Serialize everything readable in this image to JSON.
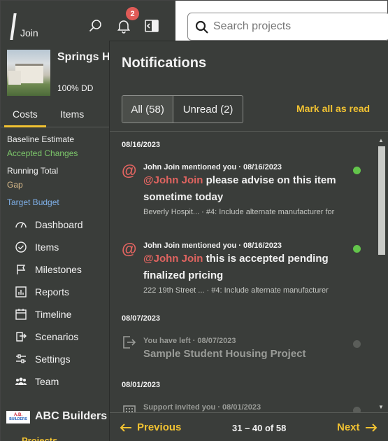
{
  "app": {
    "brand": "Join"
  },
  "header": {
    "notification_count": "2",
    "search": {
      "placeholder": "Search projects",
      "value": ""
    }
  },
  "project": {
    "name": "Springs He",
    "status": "100% DD",
    "tabs": [
      "Costs",
      "Items"
    ]
  },
  "budget": {
    "baseline": "Baseline Estimate",
    "accepted": "Accepted Changes",
    "running": "Running Total",
    "gap": "Gap",
    "target": "Target Budget"
  },
  "nav": {
    "items": [
      {
        "label": "Dashboard",
        "icon": "gauge-icon"
      },
      {
        "label": "Items",
        "icon": "check-circle-icon"
      },
      {
        "label": "Milestones",
        "icon": "flag-icon"
      },
      {
        "label": "Reports",
        "icon": "bar-chart-icon"
      },
      {
        "label": "Timeline",
        "icon": "calendar-icon"
      },
      {
        "label": "Scenarios",
        "icon": "scenarios-icon"
      },
      {
        "label": "Settings",
        "icon": "sliders-icon"
      },
      {
        "label": "Team",
        "icon": "team-icon"
      }
    ]
  },
  "company": {
    "name": "ABC Builders",
    "logo_line1": "A.B.",
    "logo_line2": "BUILDERS",
    "projects_label": "Projects"
  },
  "notifications": {
    "title": "Notifications",
    "filters": {
      "all": "All (58)",
      "unread": "Unread (2)"
    },
    "mark_all": "Mark all as read",
    "groups": [
      {
        "date": "08/16/2023"
      },
      {
        "date": "08/07/2023"
      },
      {
        "date": "08/01/2023"
      }
    ],
    "items": [
      {
        "meta": "John Join mentioned you · 08/16/2023",
        "mention": "@John Join",
        "text": " please advise on this item sometime today",
        "sub": "Beverly Hospit... · #4: Include alternate manufacturer for",
        "unread": true
      },
      {
        "meta": "John Join mentioned you · 08/16/2023",
        "mention": "@John Join",
        "text": " this is accepted pending finalized pricing",
        "sub": "222 19th Street ... · #4: Include alternate manufacturer",
        "unread": true
      },
      {
        "meta": "You have left · 08/07/2023",
        "text": "Sample Student Housing Project",
        "unread": false
      },
      {
        "meta": "Support invited you · 08/01/2023",
        "unread": false
      }
    ],
    "pager": {
      "previous": "Previous",
      "count": "31 – 40 of 58",
      "next": "Next"
    }
  },
  "colors": {
    "sidebar_bg": "#3a3d3a",
    "accent_yellow": "#f1c232",
    "mention_red": "#e06460",
    "accepted_green": "#7dc86b",
    "gap_tan": "#d7b98a",
    "target_blue": "#7fb0e8",
    "unread_dot": "#63c54b",
    "badge_red": "#e05b57"
  }
}
